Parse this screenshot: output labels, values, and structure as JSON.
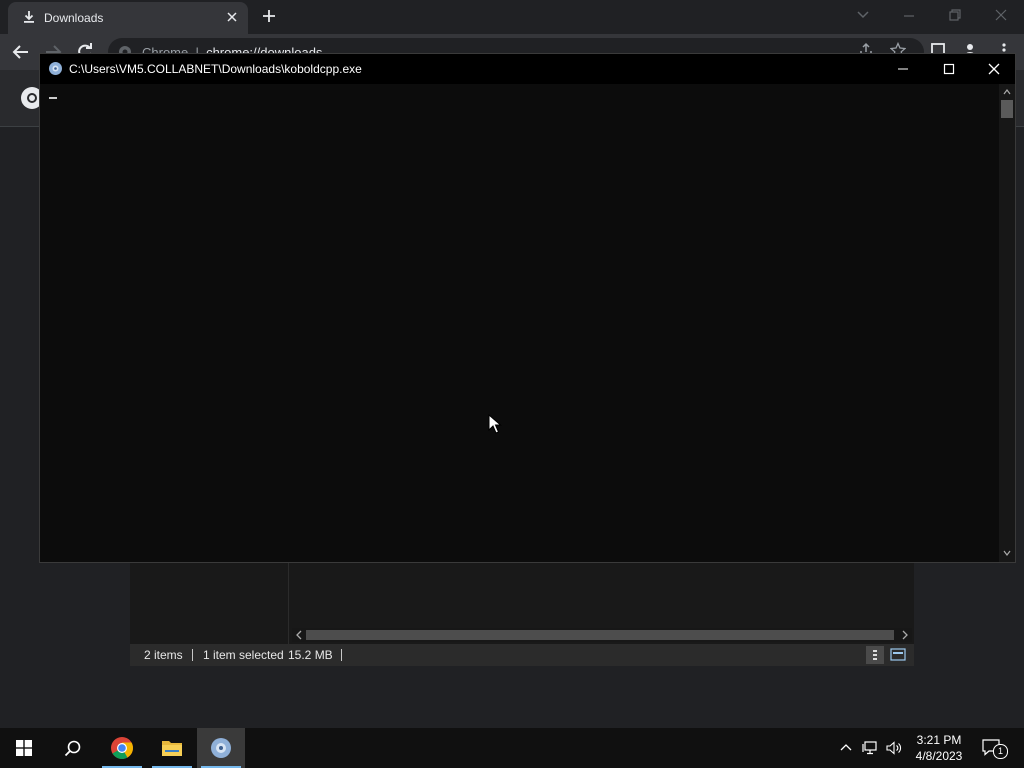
{
  "chrome": {
    "tab_title": "Downloads",
    "url_prefix": "Chrome",
    "url_path": "chrome://downloads"
  },
  "console": {
    "title": "C:\\Users\\VM5.COLLABNET\\Downloads\\koboldcpp.exe"
  },
  "explorer": {
    "item_count": "2 items",
    "selection": "1 item selected",
    "size": "15.2 MB"
  },
  "taskbar": {
    "time": "3:21 PM",
    "date": "4/8/2023",
    "notification_count": "1",
    "pinned": [
      "start-icon",
      "search-icon",
      "chrome-icon",
      "file-explorer-icon",
      "koboldcpp-icon"
    ]
  },
  "colors": {
    "console_bg": "#0c0c0c",
    "taskbar_bg": "#101010",
    "chrome_frame": "#202124",
    "accent": "#76b9ed"
  }
}
